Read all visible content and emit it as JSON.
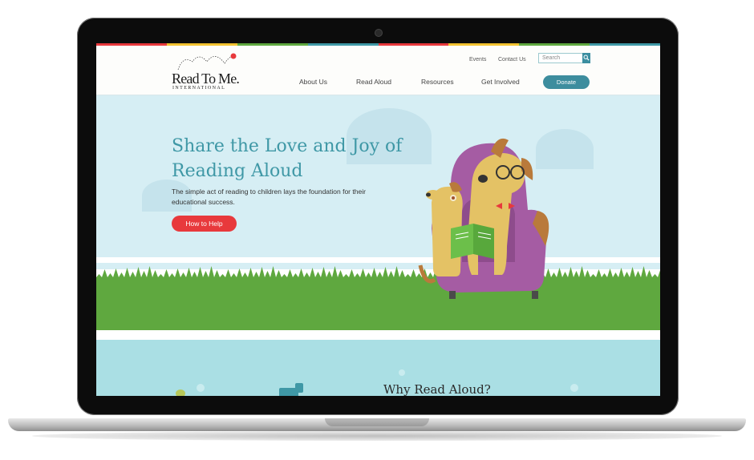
{
  "header": {
    "logo_text": "Read To Me.",
    "logo_sub": "INTERNATIONAL",
    "util_links": [
      "Events",
      "Contact Us"
    ],
    "search_placeholder": "Search",
    "nav": [
      "About Us",
      "Read Aloud",
      "Resources",
      "Get Involved"
    ],
    "donate_label": "Donate"
  },
  "hero": {
    "title": "Share the Love and Joy of Reading Aloud",
    "text": "The simple act of reading to children lays the foundation for their educational success.",
    "cta_label": "How to Help"
  },
  "section2": {
    "title": "Why Read Aloud?"
  },
  "colors": {
    "accent_teal": "#3f98a6",
    "cta_red": "#e8393c",
    "hero_bg": "#d6eef4",
    "grass": "#5fa83f",
    "chair": "#a55ca3",
    "strip": [
      "#e8393c",
      "#f2c230",
      "#5fa83f",
      "#3f98a6",
      "#e8393c",
      "#f2c230",
      "#5fa83f",
      "#3f98a6"
    ]
  },
  "icons": [
    "search-icon",
    "logo-arc-icon",
    "dog-reading-illustration",
    "grass-decoration"
  ]
}
